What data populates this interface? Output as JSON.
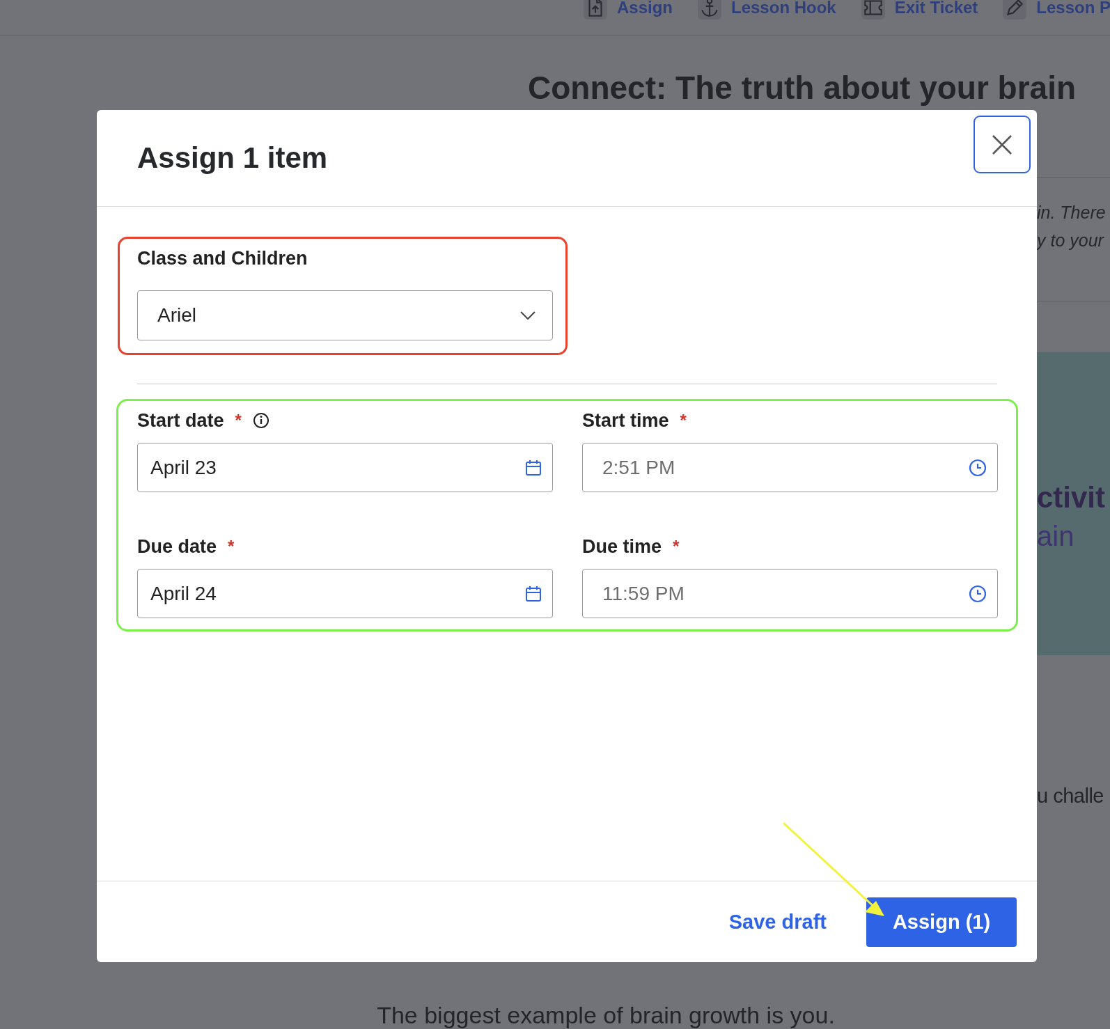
{
  "background": {
    "nav": [
      {
        "label": "Assign"
      },
      {
        "label": "Lesson Hook"
      },
      {
        "label": "Exit Ticket"
      },
      {
        "label": "Lesson P"
      }
    ],
    "heading": "Connect: The truth about your brain",
    "intro_lines": [
      "in. There",
      "y to your"
    ],
    "banner": {
      "title": "ctivit",
      "subtitle": "ain"
    },
    "body_fragment": "u challe",
    "section_text": "The biggest example of brain growth is you."
  },
  "modal": {
    "title": "Assign 1 item",
    "class_field": {
      "label": "Class and Children",
      "value": "Ariel"
    },
    "schedule_fields": [
      {
        "kind": "date",
        "label": "Start date",
        "required_mark": "*",
        "info_icon": true,
        "value": "April 23"
      },
      {
        "kind": "time",
        "label": "Start time",
        "required_mark": "*",
        "info_icon": false,
        "placeholder": "2:51 PM"
      },
      {
        "kind": "date",
        "label": "Due date",
        "required_mark": "*",
        "info_icon": false,
        "value": "April 24"
      },
      {
        "kind": "time",
        "label": "Due time",
        "required_mark": "*",
        "info_icon": false,
        "placeholder": "11:59 PM"
      }
    ],
    "secondary_action": "Save draft",
    "primary_action": "Assign (1)"
  }
}
